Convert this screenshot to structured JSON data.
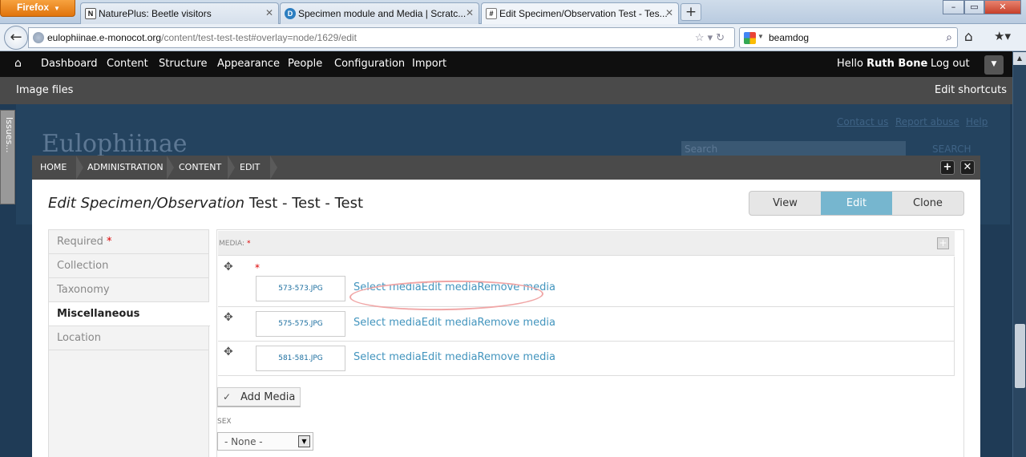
{
  "browser": {
    "firefox_label": "Firefox",
    "tabs": [
      {
        "title": "NaturePlus: Beetle visitors",
        "icon": "N"
      },
      {
        "title": "Specimen module and Media | Scratc...",
        "icon": "D"
      },
      {
        "title": "Edit Specimen/Observation Test - Tes...",
        "icon": "#"
      }
    ],
    "url_domain": "eulophiinae.e-monocot.org",
    "url_path": "/content/test-test-test#overlay=node/1629/edit",
    "url_prefix": "",
    "search_query": "beamdog"
  },
  "toolbar": {
    "items": [
      "Dashboard",
      "Content",
      "Structure",
      "Appearance",
      "People",
      "Configuration",
      "Import"
    ],
    "greeting": "Hello ",
    "user": "Ruth Bone",
    "logout": "Log out"
  },
  "shortcuts": {
    "image_files": "Image files",
    "edit_shortcuts": "Edit shortcuts"
  },
  "background": {
    "site_name": "Eulophiinae",
    "links": [
      "Contact us",
      "Report abuse",
      "Help"
    ],
    "search_placeholder": "Search",
    "search_button": "SEARCH",
    "issues_tab": "Issues..."
  },
  "overlay": {
    "breadcrumb": [
      "HOME",
      "ADMINISTRATION",
      "CONTENT",
      "EDIT"
    ],
    "title_italic": "Edit Specimen/Observation",
    "title_rest": " Test - Test - Test",
    "tabs": [
      "View",
      "Edit",
      "Clone"
    ],
    "vertical_tabs": [
      "Required",
      "Collection",
      "Taxonomy",
      "Miscellaneous",
      "Location"
    ],
    "required_mark": "*",
    "media_label": "MEDIA:",
    "media_rows": [
      {
        "file": "573-573.JPG",
        "select": "Select media",
        "edit": "Edit media",
        "remove": "Remove media"
      },
      {
        "file": "575-575.JPG",
        "select": "Select media",
        "edit": "Edit media",
        "remove": "Remove media"
      },
      {
        "file": "581-581.JPG",
        "select": "Select media",
        "edit": "Edit media",
        "remove": "Remove media"
      }
    ],
    "add_media": "Add Media",
    "sex_label": "SEX",
    "sex_value": "- None -"
  },
  "colors": {
    "accent": "#76b6cf",
    "link": "#4395be",
    "toolbar": "#0f0f0f",
    "required": "#dd0000"
  }
}
